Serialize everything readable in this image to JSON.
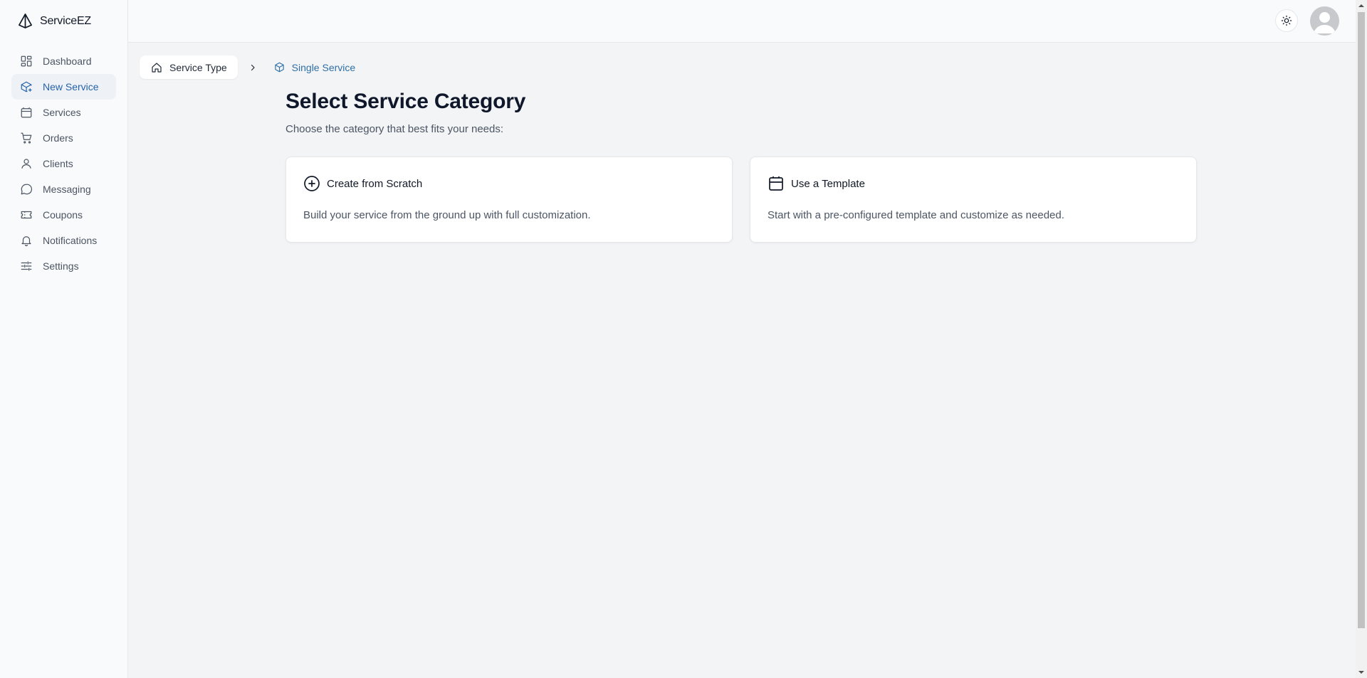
{
  "brand": {
    "name": "ServiceEZ"
  },
  "sidebar": {
    "items": [
      {
        "label": "Dashboard",
        "icon": "dashboard-icon"
      },
      {
        "label": "New Service",
        "icon": "box-plus-icon",
        "active": true
      },
      {
        "label": "Services",
        "icon": "package-icon"
      },
      {
        "label": "Orders",
        "icon": "cart-icon"
      },
      {
        "label": "Clients",
        "icon": "user-icon"
      },
      {
        "label": "Messaging",
        "icon": "message-icon"
      },
      {
        "label": "Coupons",
        "icon": "ticket-icon"
      },
      {
        "label": "Notifications",
        "icon": "bell-icon"
      },
      {
        "label": "Settings",
        "icon": "sliders-icon"
      }
    ]
  },
  "header": {
    "theme_toggle_icon": "sun-icon",
    "avatar_icon": "user-avatar-icon"
  },
  "breadcrumb": {
    "home": "Service Type",
    "current": "Single Service"
  },
  "main": {
    "title": "Select Service Category",
    "subtitle": "Choose the category that best fits your needs:",
    "cards": [
      {
        "title": "Create from Scratch",
        "description": "Build your service from the ground up with full customization.",
        "icon": "plus-circle-icon"
      },
      {
        "title": "Use a Template",
        "description": "Start with a pre-configured template and customize as needed.",
        "icon": "template-box-icon"
      }
    ]
  },
  "colors": {
    "accent": "#2f6fa6",
    "background": "#f3f4f6",
    "sidebar": "#f9fafb"
  }
}
